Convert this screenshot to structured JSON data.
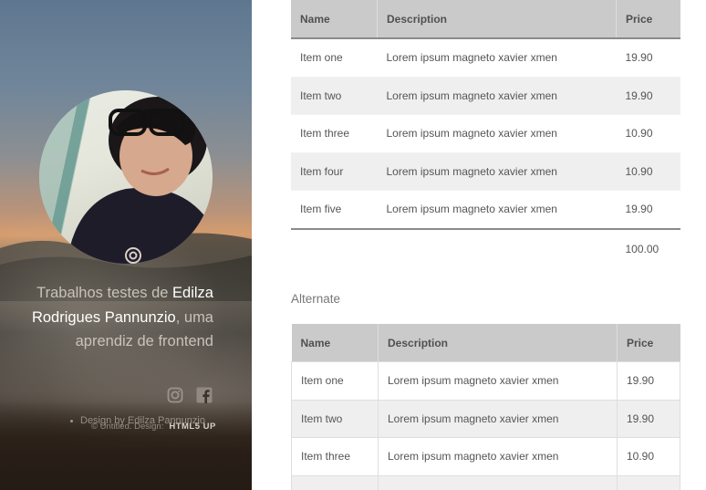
{
  "sidebar": {
    "intro_prefix": "Trabalhos testes de",
    "intro_name": "Edilza Rodrigues Pannunzio",
    "intro_suffix": ", uma aprendiz de frontend",
    "credits_line1": "Design by Edilza Pannunzio",
    "credits_line2": "© Untitled. Design:",
    "credits_html5": "HTML5 UP",
    "icons": [
      "instagram-icon",
      "facebook-icon"
    ],
    "colors": {
      "highlight": "#ffffff",
      "muted_text": "#c8c2ba"
    }
  },
  "table1": {
    "headers": {
      "name": "Name",
      "description": "Description",
      "price": "Price"
    },
    "rows": [
      {
        "name": "Item one",
        "description": "Lorem ipsum magneto xavier xmen",
        "price": "19.90"
      },
      {
        "name": "Item two",
        "description": "Lorem ipsum magneto xavier xmen",
        "price": "19.90"
      },
      {
        "name": "Item three",
        "description": "Lorem ipsum magneto xavier xmen",
        "price": "10.90"
      },
      {
        "name": "Item four",
        "description": "Lorem ipsum magneto xavier xmen",
        "price": "10.90"
      },
      {
        "name": "Item five",
        "description": "Lorem ipsum magneto xavier xmen",
        "price": "19.90"
      }
    ],
    "total": "100.00"
  },
  "alternate_title": "Alternate",
  "table2": {
    "headers": {
      "name": "Name",
      "description": "Description",
      "price": "Price"
    },
    "rows": [
      {
        "name": "Item one",
        "description": "Lorem ipsum magneto xavier xmen",
        "price": "19.90"
      },
      {
        "name": "Item two",
        "description": "Lorem ipsum magneto xavier xmen",
        "price": "19.90"
      },
      {
        "name": "Item three",
        "description": "Lorem ipsum magneto xavier xmen",
        "price": "10.90"
      },
      {
        "name": "",
        "description": "",
        "price": ""
      }
    ]
  },
  "colors": {
    "header_bg": "#cacaca",
    "stripe_bg": "#efefef",
    "border_dark": "#8a8a8a"
  }
}
